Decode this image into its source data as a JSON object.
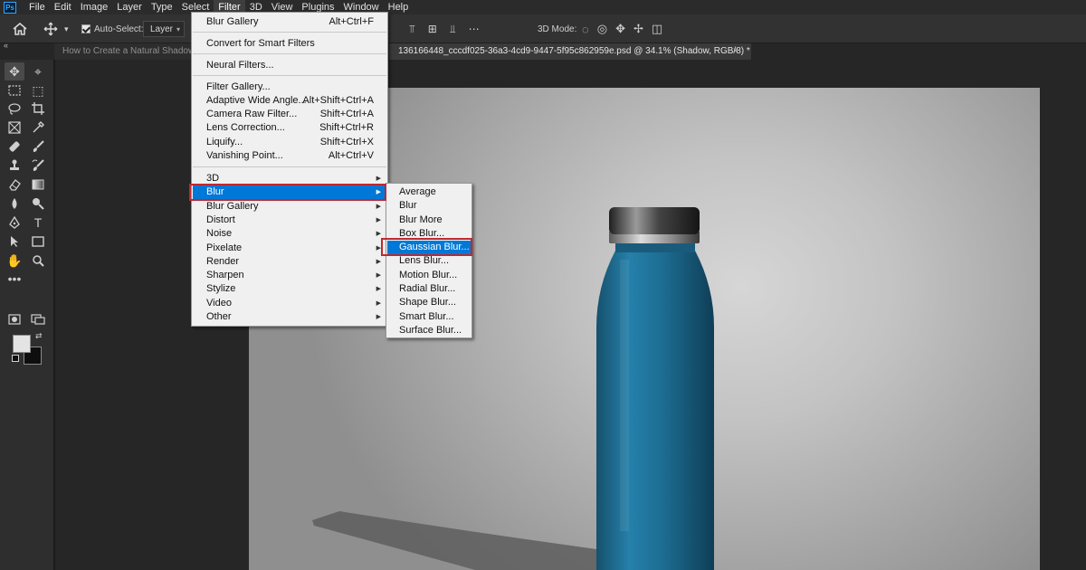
{
  "app": {
    "logo": "Ps"
  },
  "menubar": {
    "items": [
      "File",
      "Edit",
      "Image",
      "Layer",
      "Type",
      "Select",
      "Filter",
      "3D",
      "View",
      "Plugins",
      "Window",
      "Help"
    ],
    "active": "Filter"
  },
  "options_bar": {
    "autoselect_label": "Auto-Select:",
    "autoselect_checked": true,
    "target_value": "Layer",
    "mode_label": "3D Mode:"
  },
  "tabs": [
    {
      "title": "How to Create a Natural Shadow in Photoshop.psd",
      "active": false
    },
    {
      "title": "136166448_cccdf025-36a3-4cd9-9447-5f95c862959e.psd @ 34.1% (Shadow, RGB/8) *",
      "active": true,
      "close": "×"
    }
  ],
  "colors": {
    "accent": "#0078d7",
    "highlight_outline": "#c0282e",
    "foreground_swatch": "#e4e4e4",
    "background_swatch": "#0e0e0e",
    "bottle": "#1f6e94"
  },
  "filter_menu": {
    "last_filter": {
      "label": "Blur Gallery",
      "shortcut": "Alt+Ctrl+F"
    },
    "convert": {
      "label": "Convert for Smart Filters"
    },
    "neural": {
      "label": "Neural Filters..."
    },
    "items": [
      {
        "label": "Filter Gallery...",
        "shortcut": ""
      },
      {
        "label": "Adaptive Wide Angle...",
        "shortcut": "Alt+Shift+Ctrl+A"
      },
      {
        "label": "Camera Raw Filter...",
        "shortcut": "Shift+Ctrl+A"
      },
      {
        "label": "Lens Correction...",
        "shortcut": "Shift+Ctrl+R"
      },
      {
        "label": "Liquify...",
        "shortcut": "Shift+Ctrl+X"
      },
      {
        "label": "Vanishing Point...",
        "shortcut": "Alt+Ctrl+V"
      }
    ],
    "submenus": [
      "3D",
      "Blur",
      "Blur Gallery",
      "Distort",
      "Noise",
      "Pixelate",
      "Render",
      "Sharpen",
      "Stylize",
      "Video",
      "Other"
    ],
    "active_submenu": "Blur"
  },
  "blur_submenu": {
    "items": [
      "Average",
      "Blur",
      "Blur More",
      "Box Blur...",
      "Gaussian Blur...",
      "Lens Blur...",
      "Motion Blur...",
      "Radial Blur...",
      "Shape Blur...",
      "Smart Blur...",
      "Surface Blur..."
    ],
    "highlighted": "Gaussian Blur..."
  }
}
